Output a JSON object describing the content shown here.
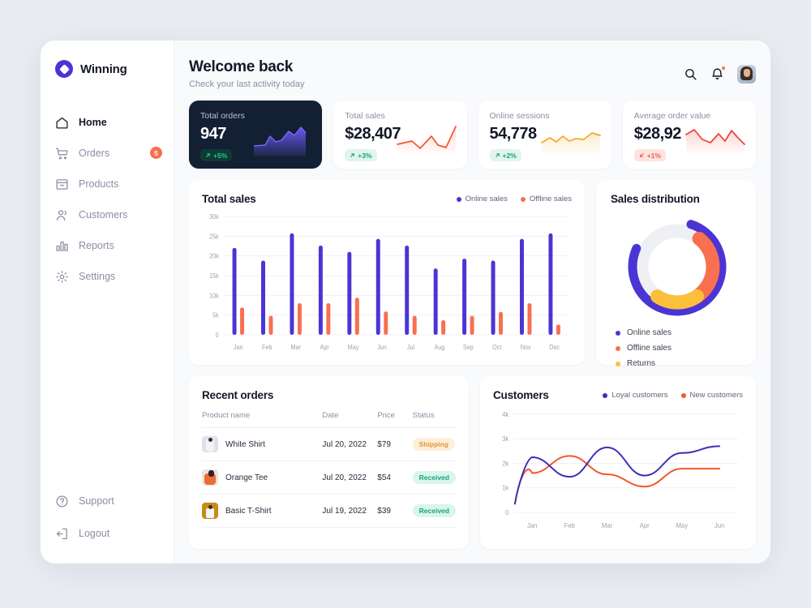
{
  "brand": {
    "name": "Winning",
    "logo_icon": "diamond-circle-icon",
    "accent": "#4a35d4"
  },
  "sidebar": {
    "items": [
      {
        "label": "Home",
        "icon": "home-icon",
        "active": true
      },
      {
        "label": "Orders",
        "icon": "cart-icon",
        "badge": "5"
      },
      {
        "label": "Products",
        "icon": "box-icon"
      },
      {
        "label": "Customers",
        "icon": "users-icon"
      },
      {
        "label": "Reports",
        "icon": "bar-chart-icon"
      },
      {
        "label": "Settings",
        "icon": "gear-icon"
      }
    ],
    "bottom_items": [
      {
        "label": "Support",
        "icon": "help-circle-icon"
      },
      {
        "label": "Logout",
        "icon": "logout-icon"
      }
    ]
  },
  "header": {
    "title": "Welcome back",
    "subtitle": "Check your last activity today",
    "search_icon": "search-icon",
    "notifications_icon": "bell-icon",
    "has_notification": true,
    "avatar_icon": "user-avatar"
  },
  "stats": [
    {
      "label": "Total orders",
      "value": "947",
      "delta": "+5%",
      "direction": "up",
      "theme": "dark",
      "spark_color": "#4a35d4"
    },
    {
      "label": "Total sales",
      "value": "$28,407",
      "delta": "+3%",
      "direction": "up",
      "theme": "light",
      "spark_color": "#f5552c"
    },
    {
      "label": "Online sessions",
      "value": "54,778",
      "delta": "+2%",
      "direction": "up",
      "theme": "light",
      "spark_color": "#f5a623"
    },
    {
      "label": "Average order value",
      "value": "$28,92",
      "delta": "+1%",
      "direction": "down",
      "theme": "light",
      "spark_color": "#ef4136"
    }
  ],
  "total_sales_card": {
    "title": "Total sales",
    "legend": [
      {
        "label": "Online sales",
        "color": "#4a35d4"
      },
      {
        "label": "Offline sales",
        "color": "#f8704f"
      }
    ]
  },
  "sales_distribution": {
    "title": "Sales distribution",
    "legend": [
      {
        "label": "Online sales",
        "color": "#4a35d4"
      },
      {
        "label": "Offline sales",
        "color": "#f8704f"
      },
      {
        "label": "Returns",
        "color": "#fbbf3c"
      }
    ]
  },
  "recent_orders": {
    "title": "Recent orders",
    "columns": [
      "Product name",
      "Date",
      "Price",
      "Status"
    ],
    "rows": [
      {
        "product": "White Shirt",
        "date": "Jul  20, 2022",
        "price": "$79",
        "status": "Shipping",
        "status_type": "shipping",
        "thumb": "t1"
      },
      {
        "product": "Orange Tee",
        "date": "Jul  20, 2022",
        "price": "$54",
        "status": "Received",
        "status_type": "received",
        "thumb": "t2"
      },
      {
        "product": "Basic T-Shirt",
        "date": "Jul  19, 2022",
        "price": "$39",
        "status": "Received",
        "status_type": "received",
        "thumb": "t3"
      }
    ]
  },
  "customers_card": {
    "title": "Customers",
    "legend": [
      {
        "label": "Loyal customers",
        "color": "#3930b8"
      },
      {
        "label": "New customers",
        "color": "#f5552c"
      }
    ]
  },
  "chart_data": [
    {
      "type": "bar",
      "title": "Total sales",
      "categories": [
        "Jan",
        "Feb",
        "Mar",
        "Apr",
        "May",
        "Jun",
        "Jul",
        "Aug",
        "Sep",
        "Oct",
        "Nov",
        "Dec"
      ],
      "series": [
        {
          "name": "Online sales",
          "color": "#4a35d4",
          "values": [
            22000,
            18800,
            25700,
            22600,
            21000,
            24300,
            22600,
            16800,
            19300,
            18800,
            24300,
            25700
          ]
        },
        {
          "name": "Offline sales",
          "color": "#f8704f",
          "values": [
            6900,
            4800,
            8000,
            8000,
            9400,
            5900,
            4800,
            3700,
            4800,
            5800,
            8000,
            2600
          ]
        }
      ],
      "ylabel": "",
      "xlabel": "",
      "yticks": [
        "0",
        "5k",
        "10k",
        "15k",
        "20k",
        "25k",
        "30k"
      ],
      "ylim": [
        0,
        30000
      ],
      "grid": true,
      "legend_position": "top-right"
    },
    {
      "type": "pie",
      "title": "Sales distribution",
      "labels": [
        "Online sales",
        "Offline sales",
        "Returns"
      ],
      "values": [
        58,
        30,
        12
      ],
      "colors": [
        "#4a35d4",
        "#f8704f",
        "#fbbf3c"
      ],
      "note": "nested donut: outer ring online sales, inner ring offline sales and returns",
      "legend_position": "bottom-left"
    },
    {
      "type": "line",
      "title": "Customers",
      "x": [
        "Jan",
        "Feb",
        "Mar",
        "Apr",
        "May",
        "Jun"
      ],
      "series": [
        {
          "name": "Loyal customers",
          "color": "#3930b8",
          "values": [
            2250,
            1450,
            2650,
            1500,
            2420,
            2700
          ]
        },
        {
          "name": "New customers",
          "color": "#f5552c",
          "values": [
            1600,
            2300,
            1550,
            1050,
            1780,
            1780
          ]
        }
      ],
      "yticks": [
        "0",
        "1k",
        "2k",
        "3k",
        "4k"
      ],
      "ylim": [
        0,
        4000
      ],
      "grid": true,
      "legend_position": "top-right"
    }
  ]
}
